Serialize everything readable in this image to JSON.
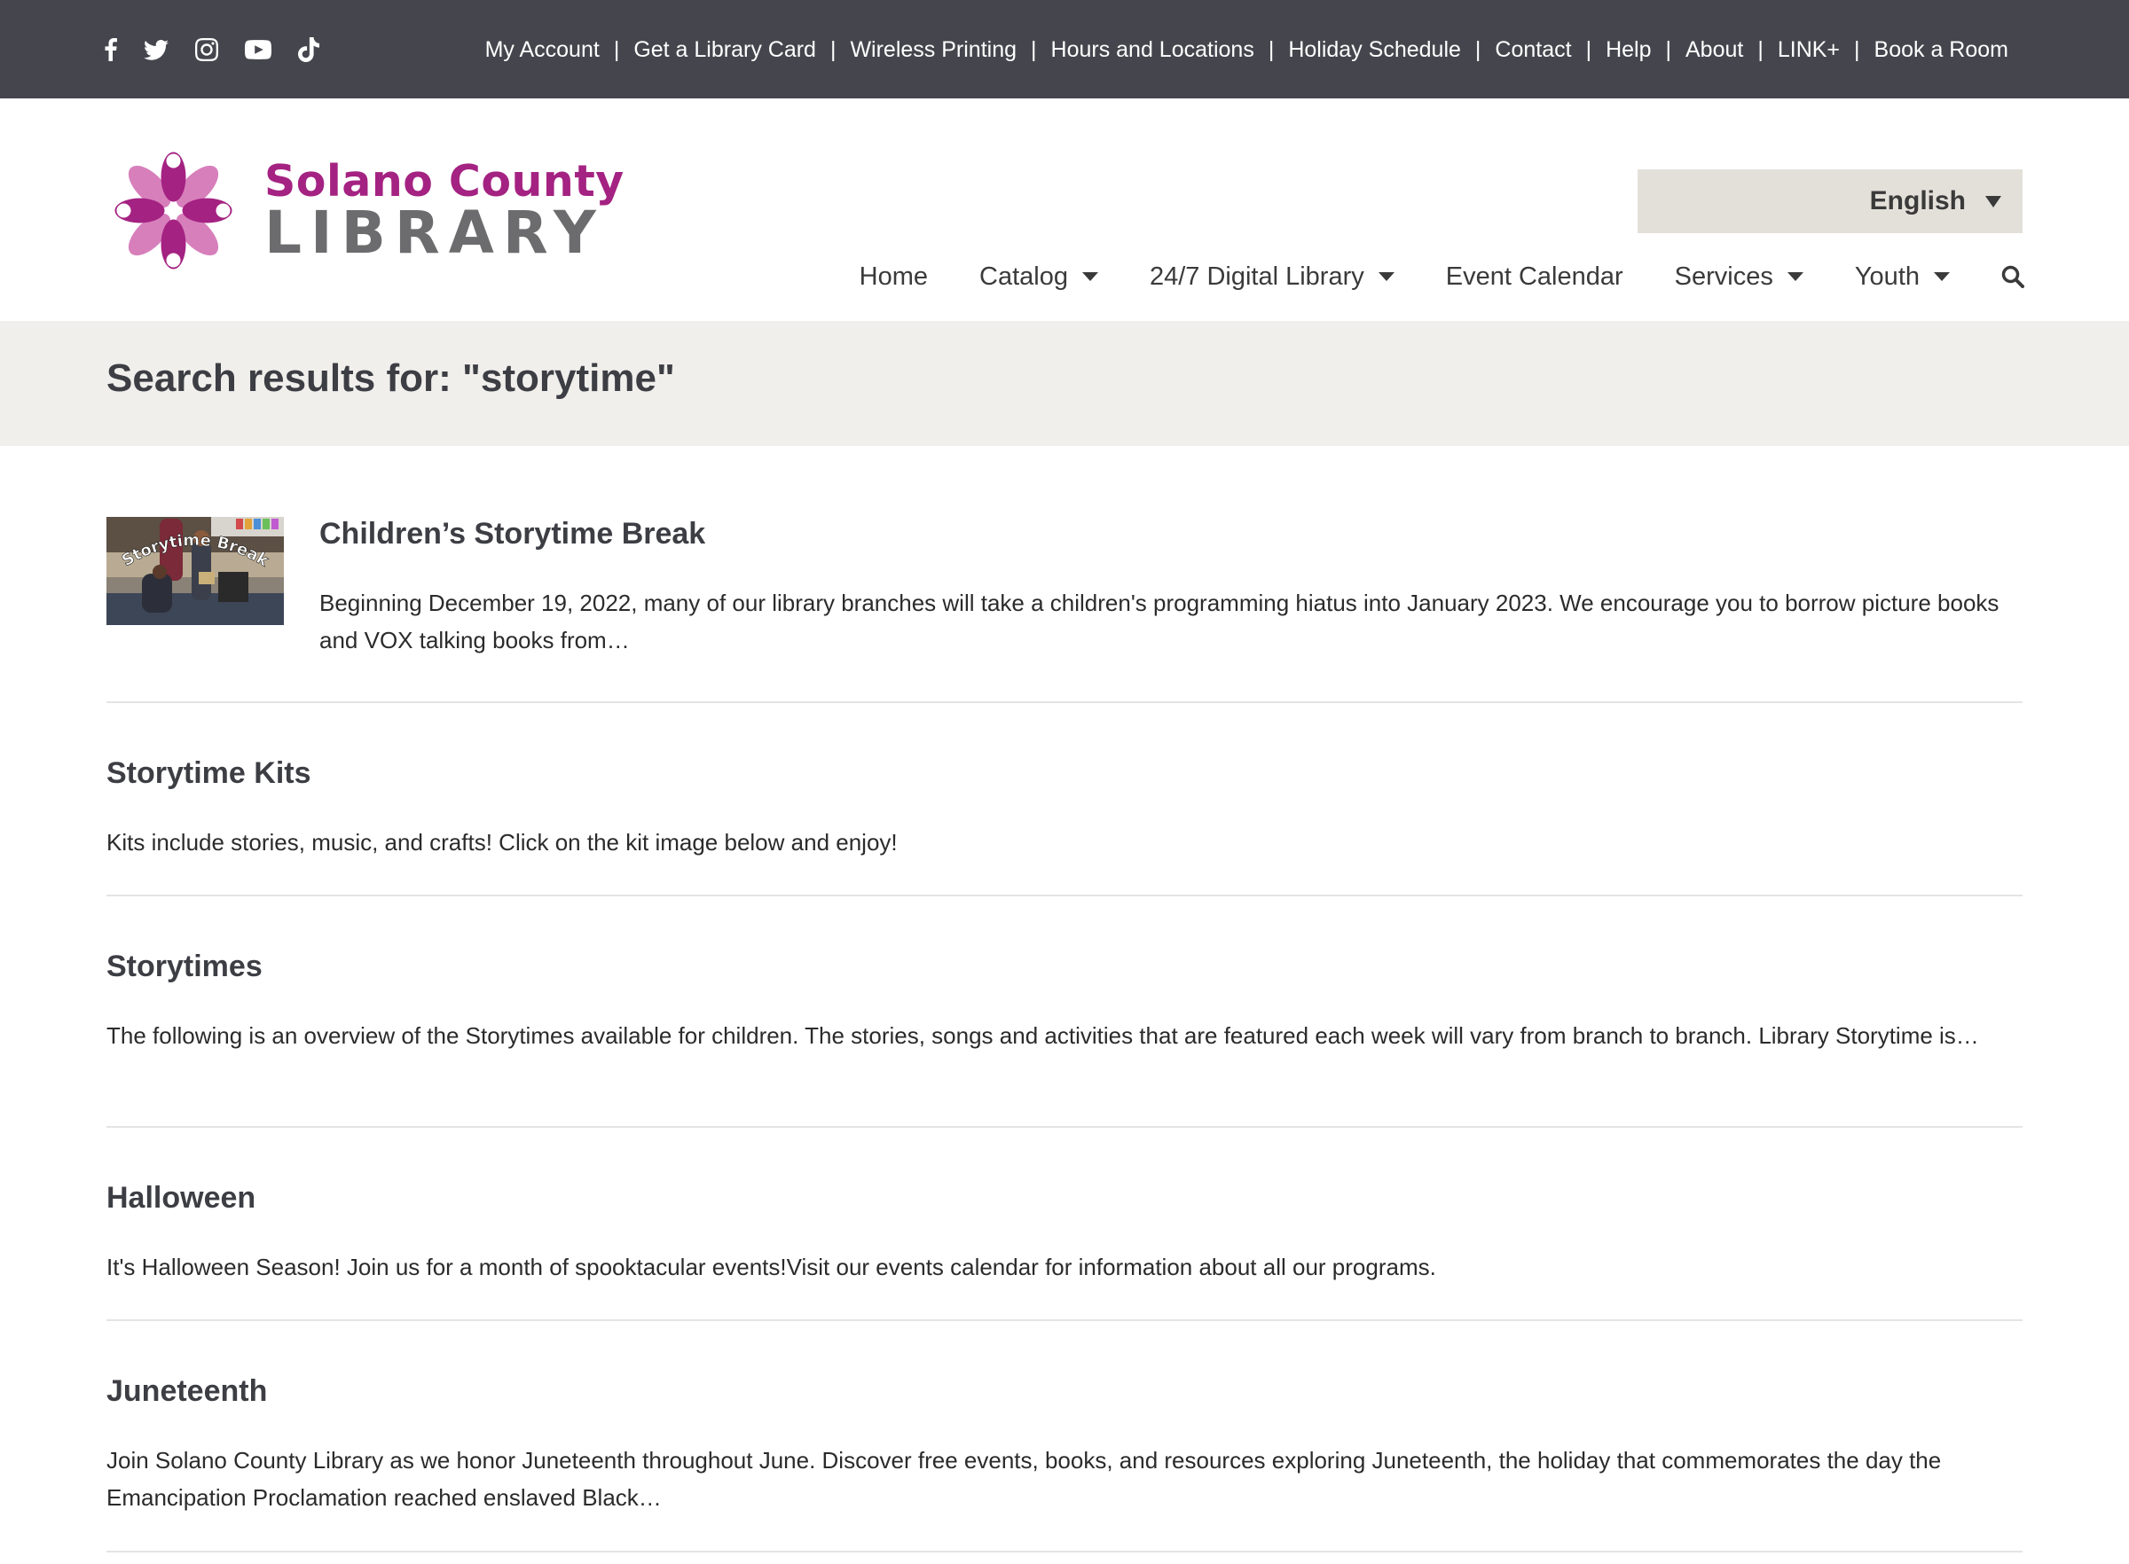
{
  "social": {
    "icons": [
      "facebook-icon",
      "twitter-icon",
      "instagram-icon",
      "youtube-icon",
      "tiktok-icon"
    ]
  },
  "utility_nav": {
    "items": [
      "My Account",
      "Get a Library Card",
      "Wireless Printing",
      "Hours and Locations",
      "Holiday Schedule",
      "Contact",
      "Help",
      "About",
      "LINK+",
      "Book a Room"
    ],
    "separator": "|"
  },
  "logo": {
    "line1": "Solano County",
    "line2": "LIBRARY"
  },
  "language": {
    "selected": "English"
  },
  "main_nav": {
    "items": [
      "Home",
      "Catalog",
      "24/7 Digital Library",
      "Event Calendar",
      "Services",
      "Youth"
    ],
    "search_icon": "search-icon"
  },
  "search": {
    "heading": "Search results for: \"storytime\""
  },
  "results": [
    {
      "title": "Children’s Storytime Break",
      "excerpt": "Beginning December 19, 2022, many of our library branches will take a children's programming hiatus into January 2023. We encourage you to borrow picture books and VOX talking books from…",
      "thumb_caption": "Storytime Break"
    },
    {
      "title": "Storytime Kits",
      "excerpt": "Kits include stories, music, and crafts! Click on the kit image below and enjoy!"
    },
    {
      "title": "Storytimes",
      "excerpt": "The following is an overview of the Storytimes available for children. The stories, songs and activities that are featured each week will vary from branch to branch. Library Storytime is…"
    },
    {
      "title": "Halloween",
      "excerpt": "It's Halloween Season! Join us for a month of spooktacular events!Visit our events calendar for information about all our programs."
    },
    {
      "title": "Juneteenth",
      "excerpt": "Join Solano County Library as we honor Juneteenth throughout June. Discover free events, books, and resources exploring Juneteenth, the holiday that commemorates the day the Emancipation Proclamation reached enslaved Black…"
    }
  ],
  "colors": {
    "topbar": "#45464d",
    "brand_magenta": "#a42282",
    "brand_gray": "#6c6c6e",
    "band": "#f0efec",
    "language_bg": "#e3e0da"
  }
}
